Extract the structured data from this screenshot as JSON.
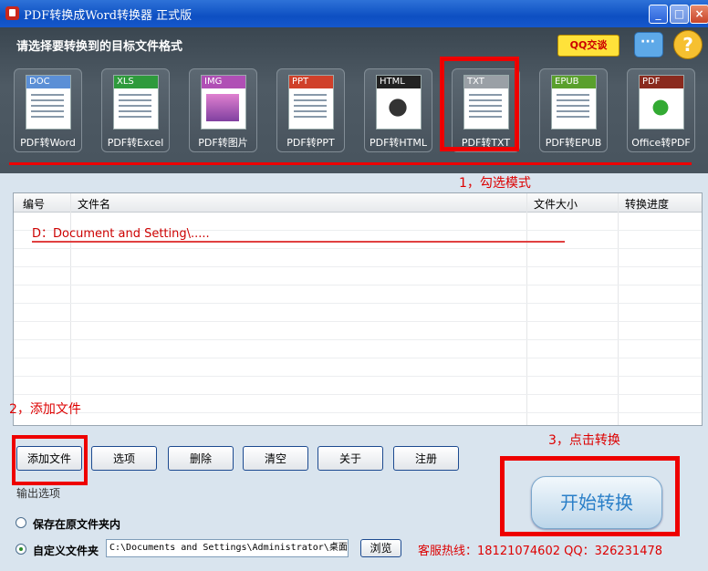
{
  "window": {
    "title": "PDF转换成Word转换器 正式版",
    "minimize": "_",
    "maximize": "□",
    "close": "×"
  },
  "header": {
    "heading": "请选择要转换到的目标文件格式",
    "qq_label": "QQ交谈",
    "help_label": "?"
  },
  "formats": [
    {
      "badge": "DOC",
      "label": "PDF转Word",
      "color": "#5b8fd6"
    },
    {
      "badge": "XLS",
      "label": "PDF转Excel",
      "color": "#2e9a3c"
    },
    {
      "badge": "IMG",
      "label": "PDF转图片",
      "color": "#b04fb5"
    },
    {
      "badge": "PPT",
      "label": "PDF转PPT",
      "color": "#d0402a"
    },
    {
      "badge": "HTML",
      "label": "PDF转HTML",
      "color": "#222222"
    },
    {
      "badge": "TXT",
      "label": "PDF转TXT",
      "color": "#9aa0a6"
    },
    {
      "badge": "EPUB",
      "label": "PDF转EPUB",
      "color": "#5aa02c"
    },
    {
      "badge": "PDF",
      "label": "Office转PDF",
      "color": "#8a2a1e"
    }
  ],
  "annotations": {
    "step1": "1，勾选模式",
    "step2": "2，添加文件",
    "step3": "3，点击转换"
  },
  "table": {
    "headers": [
      "编号",
      "文件名",
      "文件大小",
      "转换进度"
    ],
    "path_hint": "D：Document and Setting\\....."
  },
  "buttons": {
    "add": "添加文件",
    "options": "选项",
    "delete": "删除",
    "clear": "清空",
    "about": "关于",
    "register": "注册",
    "start": "开始转换"
  },
  "output": {
    "legend": "输出选项",
    "save_original": "保存在原文件夹内",
    "custom_folder": "自定义文件夹",
    "path": "C:\\Documents and Settings\\Administrator\\桌面",
    "browse": "浏览"
  },
  "hotline": "客服热线：18121074602 QQ：326231478"
}
